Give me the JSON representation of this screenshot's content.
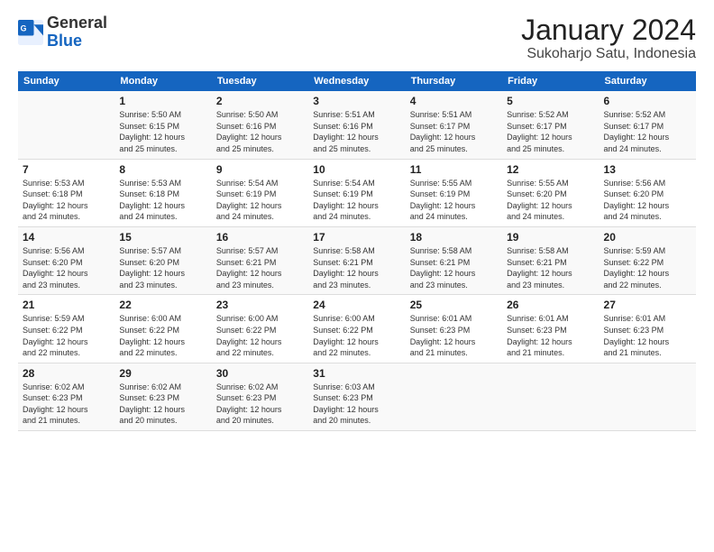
{
  "header": {
    "logo_general": "General",
    "logo_blue": "Blue",
    "month_title": "January 2024",
    "location": "Sukoharjo Satu, Indonesia"
  },
  "days_of_week": [
    "Sunday",
    "Monday",
    "Tuesday",
    "Wednesday",
    "Thursday",
    "Friday",
    "Saturday"
  ],
  "weeks": [
    [
      {
        "day": "",
        "info": ""
      },
      {
        "day": "1",
        "info": "Sunrise: 5:50 AM\nSunset: 6:15 PM\nDaylight: 12 hours\nand 25 minutes."
      },
      {
        "day": "2",
        "info": "Sunrise: 5:50 AM\nSunset: 6:16 PM\nDaylight: 12 hours\nand 25 minutes."
      },
      {
        "day": "3",
        "info": "Sunrise: 5:51 AM\nSunset: 6:16 PM\nDaylight: 12 hours\nand 25 minutes."
      },
      {
        "day": "4",
        "info": "Sunrise: 5:51 AM\nSunset: 6:17 PM\nDaylight: 12 hours\nand 25 minutes."
      },
      {
        "day": "5",
        "info": "Sunrise: 5:52 AM\nSunset: 6:17 PM\nDaylight: 12 hours\nand 25 minutes."
      },
      {
        "day": "6",
        "info": "Sunrise: 5:52 AM\nSunset: 6:17 PM\nDaylight: 12 hours\nand 24 minutes."
      }
    ],
    [
      {
        "day": "7",
        "info": "Sunrise: 5:53 AM\nSunset: 6:18 PM\nDaylight: 12 hours\nand 24 minutes."
      },
      {
        "day": "8",
        "info": "Sunrise: 5:53 AM\nSunset: 6:18 PM\nDaylight: 12 hours\nand 24 minutes."
      },
      {
        "day": "9",
        "info": "Sunrise: 5:54 AM\nSunset: 6:19 PM\nDaylight: 12 hours\nand 24 minutes."
      },
      {
        "day": "10",
        "info": "Sunrise: 5:54 AM\nSunset: 6:19 PM\nDaylight: 12 hours\nand 24 minutes."
      },
      {
        "day": "11",
        "info": "Sunrise: 5:55 AM\nSunset: 6:19 PM\nDaylight: 12 hours\nand 24 minutes."
      },
      {
        "day": "12",
        "info": "Sunrise: 5:55 AM\nSunset: 6:20 PM\nDaylight: 12 hours\nand 24 minutes."
      },
      {
        "day": "13",
        "info": "Sunrise: 5:56 AM\nSunset: 6:20 PM\nDaylight: 12 hours\nand 24 minutes."
      }
    ],
    [
      {
        "day": "14",
        "info": "Sunrise: 5:56 AM\nSunset: 6:20 PM\nDaylight: 12 hours\nand 23 minutes."
      },
      {
        "day": "15",
        "info": "Sunrise: 5:57 AM\nSunset: 6:20 PM\nDaylight: 12 hours\nand 23 minutes."
      },
      {
        "day": "16",
        "info": "Sunrise: 5:57 AM\nSunset: 6:21 PM\nDaylight: 12 hours\nand 23 minutes."
      },
      {
        "day": "17",
        "info": "Sunrise: 5:58 AM\nSunset: 6:21 PM\nDaylight: 12 hours\nand 23 minutes."
      },
      {
        "day": "18",
        "info": "Sunrise: 5:58 AM\nSunset: 6:21 PM\nDaylight: 12 hours\nand 23 minutes."
      },
      {
        "day": "19",
        "info": "Sunrise: 5:58 AM\nSunset: 6:21 PM\nDaylight: 12 hours\nand 23 minutes."
      },
      {
        "day": "20",
        "info": "Sunrise: 5:59 AM\nSunset: 6:22 PM\nDaylight: 12 hours\nand 22 minutes."
      }
    ],
    [
      {
        "day": "21",
        "info": "Sunrise: 5:59 AM\nSunset: 6:22 PM\nDaylight: 12 hours\nand 22 minutes."
      },
      {
        "day": "22",
        "info": "Sunrise: 6:00 AM\nSunset: 6:22 PM\nDaylight: 12 hours\nand 22 minutes."
      },
      {
        "day": "23",
        "info": "Sunrise: 6:00 AM\nSunset: 6:22 PM\nDaylight: 12 hours\nand 22 minutes."
      },
      {
        "day": "24",
        "info": "Sunrise: 6:00 AM\nSunset: 6:22 PM\nDaylight: 12 hours\nand 22 minutes."
      },
      {
        "day": "25",
        "info": "Sunrise: 6:01 AM\nSunset: 6:23 PM\nDaylight: 12 hours\nand 21 minutes."
      },
      {
        "day": "26",
        "info": "Sunrise: 6:01 AM\nSunset: 6:23 PM\nDaylight: 12 hours\nand 21 minutes."
      },
      {
        "day": "27",
        "info": "Sunrise: 6:01 AM\nSunset: 6:23 PM\nDaylight: 12 hours\nand 21 minutes."
      }
    ],
    [
      {
        "day": "28",
        "info": "Sunrise: 6:02 AM\nSunset: 6:23 PM\nDaylight: 12 hours\nand 21 minutes."
      },
      {
        "day": "29",
        "info": "Sunrise: 6:02 AM\nSunset: 6:23 PM\nDaylight: 12 hours\nand 20 minutes."
      },
      {
        "day": "30",
        "info": "Sunrise: 6:02 AM\nSunset: 6:23 PM\nDaylight: 12 hours\nand 20 minutes."
      },
      {
        "day": "31",
        "info": "Sunrise: 6:03 AM\nSunset: 6:23 PM\nDaylight: 12 hours\nand 20 minutes."
      },
      {
        "day": "",
        "info": ""
      },
      {
        "day": "",
        "info": ""
      },
      {
        "day": "",
        "info": ""
      }
    ]
  ]
}
